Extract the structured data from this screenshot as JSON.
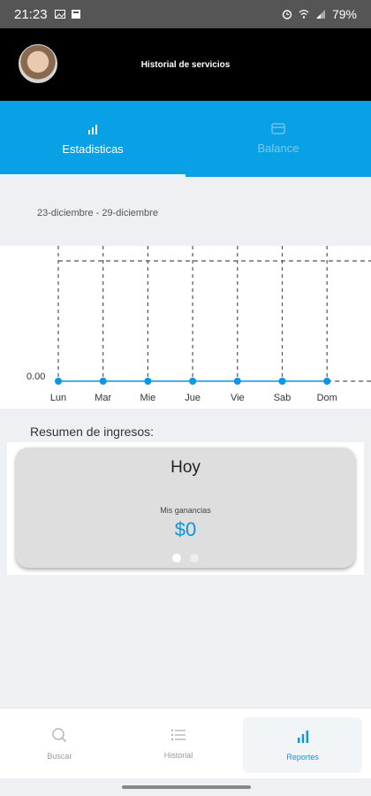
{
  "status_bar": {
    "time": "21:23",
    "battery": "79%"
  },
  "header": {
    "title": "Historial de servicios"
  },
  "tabs": [
    {
      "label": "Estadisticas",
      "icon": "bar-chart-icon",
      "active": true
    },
    {
      "label": "Balance",
      "icon": "card-icon",
      "active": false
    }
  ],
  "date_range": "23-diciembre - 29-diciembre",
  "chart_data": {
    "type": "line",
    "categories": [
      "Lun",
      "Mar",
      "Mie",
      "Jue",
      "Vie",
      "Sab",
      "Dom"
    ],
    "values": [
      0,
      0,
      0,
      0,
      0,
      0,
      0
    ],
    "y_tick_label": "0.00",
    "grid": true,
    "color": "#0a96e0"
  },
  "summary": {
    "title": "Resumen de ingresos:",
    "card": {
      "period": "Hoy",
      "label": "Mis ganancias",
      "amount": "$0"
    },
    "pages": 2,
    "active_page": 0
  },
  "bottom_nav": [
    {
      "label": "Buscar",
      "icon": "search-icon",
      "active": false
    },
    {
      "label": "Historial",
      "icon": "list-icon",
      "active": false
    },
    {
      "label": "Reportes",
      "icon": "bar-chart-icon",
      "active": true
    }
  ],
  "colors": {
    "accent": "#0aa0e6",
    "amount": "#0a96e0"
  }
}
